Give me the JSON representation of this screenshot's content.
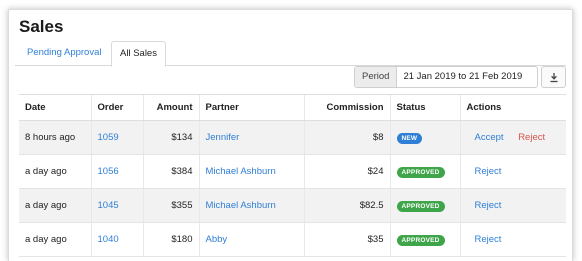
{
  "page": {
    "title": "Sales"
  },
  "tabs": [
    {
      "label": "Pending Approval",
      "active": false
    },
    {
      "label": "All Sales",
      "active": true
    }
  ],
  "period": {
    "label": "Period",
    "value": "21 Jan 2019 to 21 Feb 2019"
  },
  "download": {
    "icon": "download-icon"
  },
  "table": {
    "headers": [
      "Date",
      "Order",
      "Amount",
      "Partner",
      "Commission",
      "Status",
      "Actions"
    ],
    "rows": [
      {
        "date": "8 hours ago",
        "order": "1059",
        "amount": "$134",
        "partner": "Jennifer",
        "commission": "$8",
        "status": "NEW",
        "status_color": "#2f7fd6",
        "actions": [
          "Accept",
          "Reject"
        ]
      },
      {
        "date": "a day ago",
        "order": "1056",
        "amount": "$384",
        "partner": "Michael Ashburn",
        "commission": "$24",
        "status": "APPROVED",
        "status_color": "#3fa54a",
        "actions": [
          "Reject"
        ]
      },
      {
        "date": "a day ago",
        "order": "1045",
        "amount": "$355",
        "partner": "Michael Ashburn",
        "commission": "$82.5",
        "status": "APPROVED",
        "status_color": "#3fa54a",
        "actions": [
          "Reject"
        ]
      },
      {
        "date": "a day ago",
        "order": "1040",
        "amount": "$180",
        "partner": "Abby",
        "commission": "$35",
        "status": "APPROVED",
        "status_color": "#3fa54a",
        "actions": [
          "Reject"
        ]
      }
    ]
  },
  "colors": {
    "link": "#2f7fd6",
    "reject_red": "#d9534f",
    "new_badge": "#2f7fd6",
    "approved_badge": "#3fa54a"
  }
}
